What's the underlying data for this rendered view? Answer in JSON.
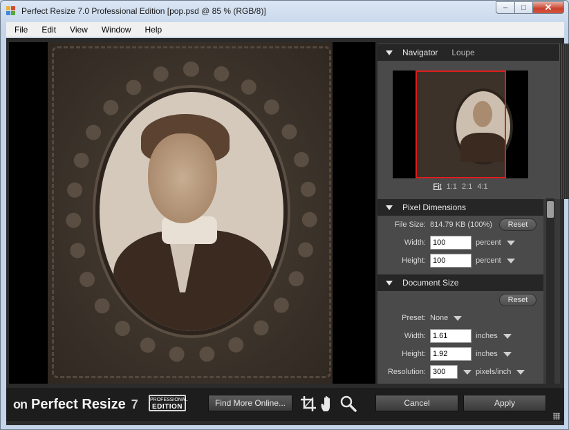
{
  "window": {
    "title": "Perfect Resize 7.0 Professional Edition [pop.psd @ 85 % (RGB/8)]",
    "controls": {
      "minimize": "–",
      "maximize": "□",
      "close": "✕"
    }
  },
  "menu": [
    "File",
    "Edit",
    "View",
    "Window",
    "Help"
  ],
  "navigator": {
    "tabs": [
      "Navigator",
      "Loupe"
    ],
    "zoom_options": [
      "Fit",
      "1:1",
      "2:1",
      "4:1"
    ]
  },
  "pixel_dimensions": {
    "title": "Pixel Dimensions",
    "file_size_label": "File Size:",
    "file_size_value": "814.79 KB (100%)",
    "reset_label": "Reset",
    "width_label": "Width:",
    "width_value": "100",
    "width_unit": "percent",
    "height_label": "Height:",
    "height_value": "100",
    "height_unit": "percent"
  },
  "document_size": {
    "title": "Document Size",
    "reset_label": "Reset",
    "preset_label": "Preset:",
    "preset_value": "None",
    "width_label": "Width:",
    "width_value": "1.61",
    "width_unit": "inches",
    "height_label": "Height:",
    "height_value": "1.92",
    "height_unit": "inches",
    "resolution_label": "Resolution:",
    "resolution_value": "300",
    "resolution_unit": "pixels/inch"
  },
  "bottom": {
    "logo_mark": "on",
    "product_name": "Perfect Resize",
    "product_version": "7",
    "badge_top": "PROFESSIONAL",
    "badge_bottom": "EDITION",
    "find_more": "Find More Online...",
    "cancel": "Cancel",
    "apply": "Apply"
  },
  "colors": {
    "navigator_frame": "#e01c1c",
    "panel_bg": "#4a4a4a",
    "panel_header": "#262626",
    "bottom_bar": "#1d1d1d"
  }
}
